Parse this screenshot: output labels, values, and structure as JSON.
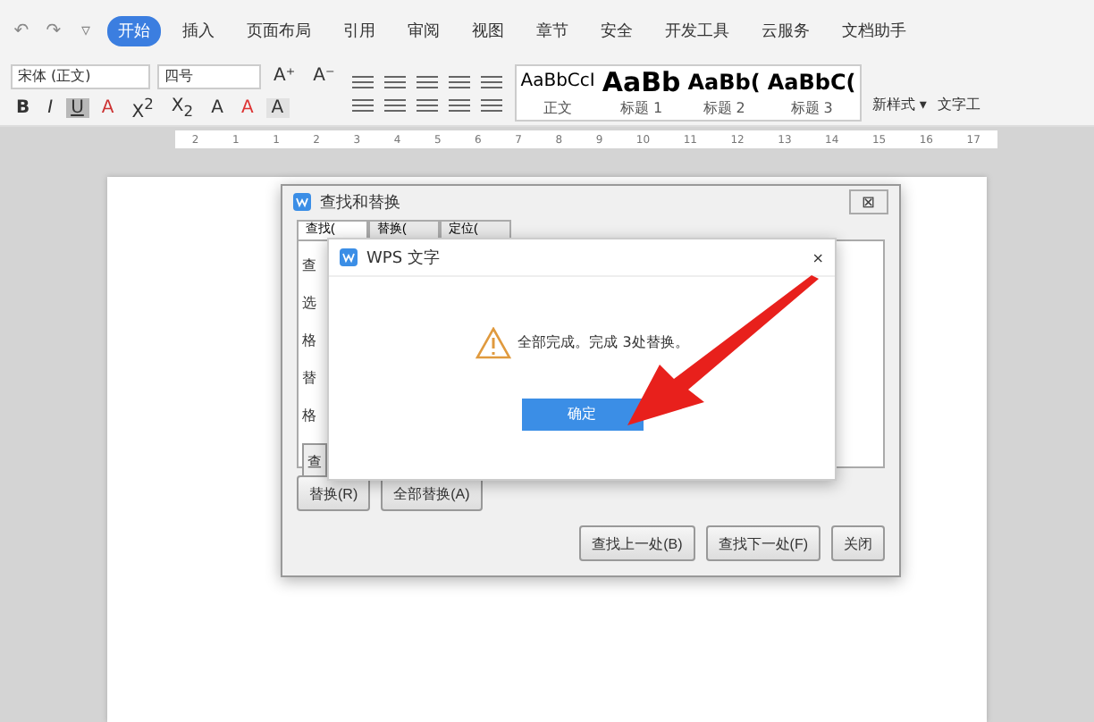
{
  "quick_access": [
    "↶",
    "↷",
    "▿"
  ],
  "menu_tabs": [
    {
      "label": "开始",
      "selected": true
    },
    {
      "label": "插入",
      "selected": false
    },
    {
      "label": "页面布局",
      "selected": false
    },
    {
      "label": "引用",
      "selected": false
    },
    {
      "label": "审阅",
      "selected": false
    },
    {
      "label": "视图",
      "selected": false
    },
    {
      "label": "章节",
      "selected": false
    },
    {
      "label": "安全",
      "selected": false
    },
    {
      "label": "开发工具",
      "selected": false
    },
    {
      "label": "云服务",
      "selected": false
    },
    {
      "label": "文档助手",
      "selected": false
    }
  ],
  "font": {
    "name": "宋体 (正文)",
    "size": "四号"
  },
  "size_buttons": [
    "A⁺",
    "A⁻"
  ],
  "format_buttons": [
    {
      "label": "B",
      "kind": "bold",
      "selected": false
    },
    {
      "label": "I",
      "kind": "italic",
      "selected": false
    },
    {
      "label": "U",
      "kind": "underline",
      "selected": true
    },
    {
      "label": "A",
      "kind": "strike",
      "selected": false
    },
    {
      "label": "X$^{2}$",
      "kind": "plain",
      "selected": false
    },
    {
      "label": "X$_{2}$",
      "kind": "plain",
      "selected": false
    },
    {
      "label": "A",
      "kind": "outline",
      "selected": false
    },
    {
      "label": "A",
      "kind": "color",
      "selected": false
    },
    {
      "label": "A",
      "kind": "shade",
      "selected": false
    }
  ],
  "styles": [
    {
      "sample": "AaBbCcI",
      "name": "正文",
      "kind": "normal"
    },
    {
      "sample": "AaBb",
      "name": "标题 1",
      "kind": "h1"
    },
    {
      "sample": "AaBb(",
      "name": "标题 2",
      "kind": "h2"
    },
    {
      "sample": "AaBbC(",
      "name": "标题 3",
      "kind": "h3"
    }
  ],
  "new_style": "新样式 ▾",
  "text_tools": "文字工",
  "ruler_marks": [
    "2",
    "1",
    "1",
    "2",
    "3",
    "4",
    "5",
    "6",
    "7",
    "8",
    "9",
    "10",
    "11",
    "12",
    "13",
    "14",
    "15",
    "16",
    "17"
  ],
  "find_replace": {
    "title": "查找和替换",
    "close": "⊠",
    "tabs": [
      {
        "label": "查找(",
        "selected": true
      },
      {
        "label": "替换(",
        "selected": false
      },
      {
        "label": "定位(",
        "selected": false
      }
    ],
    "labels": [
      "查",
      "选",
      "格",
      "替",
      "格"
    ],
    "hidden_button": "查",
    "buttons_row1": [
      "替换(R)",
      "全部替换(A)"
    ],
    "buttons_row2": [
      "查找上一处(B)",
      "查找下一处(F)",
      "关闭"
    ]
  },
  "message": {
    "title": "WPS 文字",
    "close": "×",
    "text": "全部完成。完成 3处替换。",
    "ok": "确定"
  }
}
